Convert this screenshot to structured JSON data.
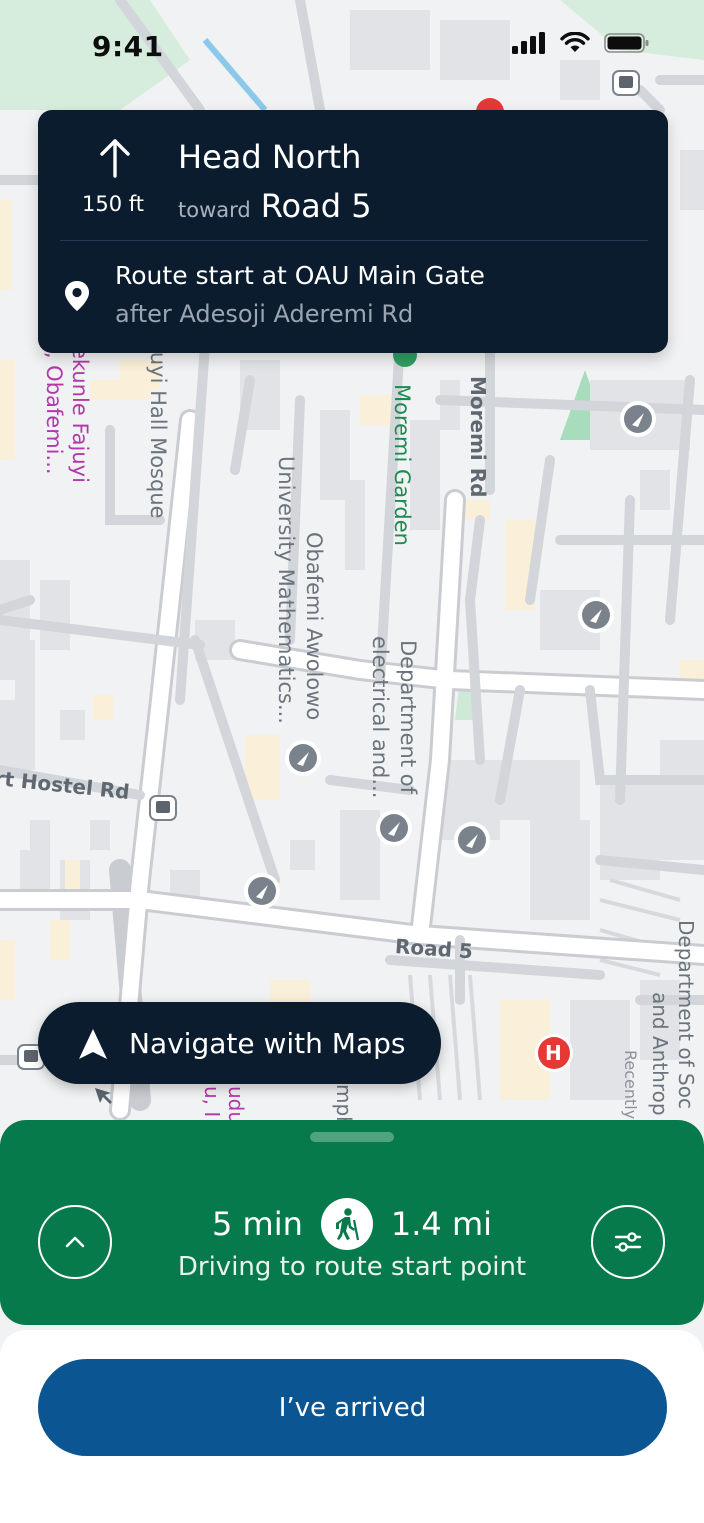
{
  "status_bar": {
    "time": "9:41"
  },
  "navigation": {
    "instruction": "Head North",
    "distance": "150 ft",
    "toward_label": "toward",
    "road": "Road 5",
    "route_start": "Route start at OAU Main Gate",
    "route_start_sub": "after Adesoji Aderemi Rd"
  },
  "map": {
    "labels": {
      "moremi_rd": "Moremi Rd",
      "moremi_garden": "Moremi Garden",
      "fajuyi_mosque": "juyi Hall Mosque",
      "fajuyi_hall_line1": "ekunle Fajuyi",
      "fajuyi_hall_line2": "l, Obafemi...",
      "math_line1": "Obafemi Awolowo",
      "math_line2": "University Mathematics...",
      "elec_line1": "Department of",
      "elec_line2": "electrical and...",
      "hostel_rd": "rt Hostel Rd",
      "road_5": "Road 5",
      "dept_soc_line1": "Department of Soc",
      "dept_soc_line2": "and Anthrop",
      "dept_soc_line3": "Recently",
      "partial_1": "udu",
      "partial_2": "u, I",
      "partial_3": "mph",
      "hospital": "H"
    }
  },
  "navigate_button": {
    "label": "Navigate with Maps"
  },
  "trip": {
    "duration": "5 min",
    "distance": "1.4 mi",
    "subtitle": "Driving to route start point"
  },
  "arrived_button": {
    "label": "I’ve arrived"
  },
  "colors": {
    "nav_card": "#0b1c2e",
    "sheet_green": "#077a4c",
    "arrived_blue": "#0b5592",
    "map_bg": "#f1f2f3"
  }
}
